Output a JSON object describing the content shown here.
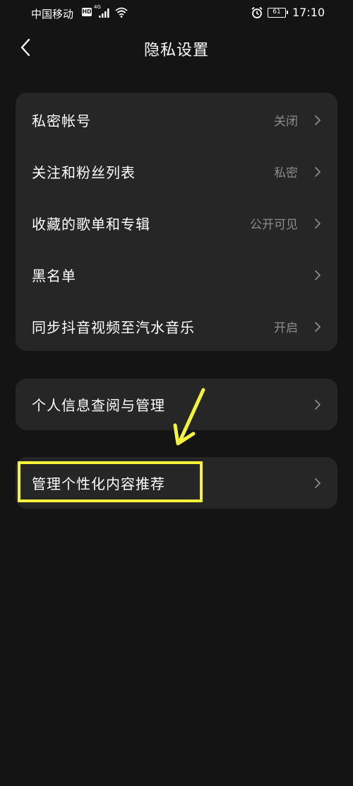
{
  "status_bar": {
    "carrier": "中国移动",
    "hd": "HD",
    "network": "4G",
    "battery": "61",
    "time": "17:10"
  },
  "header": {
    "title": "隐私设置"
  },
  "sections": [
    {
      "items": [
        {
          "label": "私密帐号",
          "value": "关闭"
        },
        {
          "label": "关注和粉丝列表",
          "value": "私密"
        },
        {
          "label": "收藏的歌单和专辑",
          "value": "公开可见"
        },
        {
          "label": "黑名单",
          "value": ""
        },
        {
          "label": "同步抖音视频至汽水音乐",
          "value": "开启"
        }
      ]
    },
    {
      "items": [
        {
          "label": "个人信息查阅与管理",
          "value": ""
        }
      ]
    },
    {
      "items": [
        {
          "label": "管理个性化内容推荐",
          "value": ""
        }
      ]
    }
  ],
  "colors": {
    "background": "#141414",
    "card": "#262626",
    "secondary_text": "#8c8c8c",
    "annotation": "#f5f23a"
  },
  "icons": {
    "back": "chevron-left-icon",
    "row": "chevron-right-icon",
    "signal": "signal-icon",
    "wifi": "wifi-icon",
    "alarm": "alarm-icon"
  }
}
